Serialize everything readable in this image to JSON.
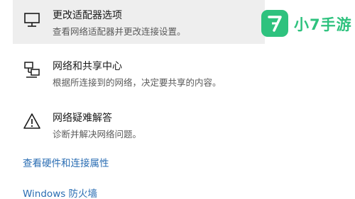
{
  "settings": {
    "items": [
      {
        "title": "更改适配器选项",
        "description": "查看网络适配器并更改连接设置。",
        "icon": "monitor-network-icon"
      },
      {
        "title": "网络和共享中心",
        "description": "根据所连接到的网络，决定要共享的内容。",
        "icon": "network-sharing-icon"
      },
      {
        "title": "网络疑难解答",
        "description": "诊断并解决网络问题。",
        "icon": "warning-icon"
      }
    ],
    "links": [
      "查看硬件和连接属性",
      "Windows 防火墙"
    ]
  },
  "watermark": {
    "text": "小7手游",
    "color": "#2ec27e"
  }
}
